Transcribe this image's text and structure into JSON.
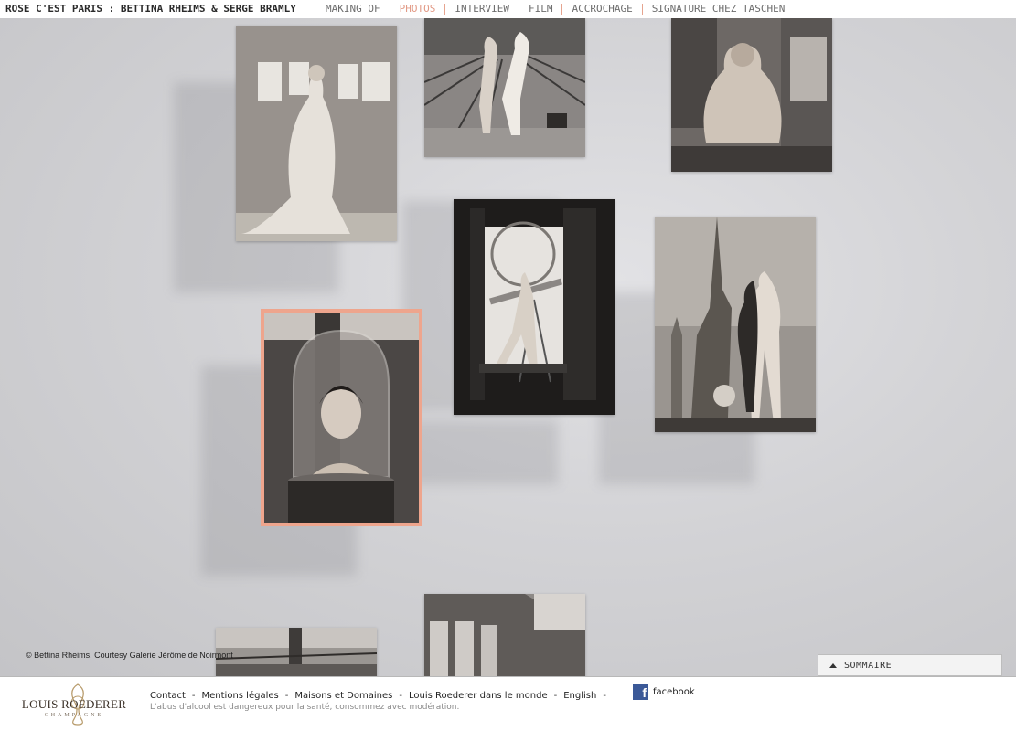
{
  "header": {
    "title": "ROSE C'EST PARIS : BETTINA RHEIMS & SERGE BRAMLY",
    "nav": [
      {
        "label": "MAKING OF",
        "active": false
      },
      {
        "label": "PHOTOS",
        "active": true
      },
      {
        "label": "INTERVIEW",
        "active": false
      },
      {
        "label": "FILM",
        "active": false
      },
      {
        "label": "ACCROCHAGE",
        "active": false
      },
      {
        "label": "SIGNATURE CHEZ TASCHEN",
        "active": false
      }
    ],
    "active_color": "#e29a86"
  },
  "gallery": {
    "selected_photo": "photo-bell-jar",
    "selection_color": "#eea58d",
    "credit": "© Bettina Rheims, Courtesy Galerie Jérôme de Noirmont"
  },
  "sommaire": {
    "label": "SOMMAIRE"
  },
  "footer": {
    "logo": {
      "brand": "LOUIS ROEDERER",
      "sub": "CHAMPAGNE"
    },
    "links": [
      "Contact",
      "Mentions légales",
      "Maisons et Domaines",
      "Louis Roederer dans le monde",
      "English"
    ],
    "facebook": {
      "icon": "f",
      "label": "facebook"
    },
    "disclaimer": "L'abus d'alcool est dangereux pour la santé, consommez avec modération."
  }
}
